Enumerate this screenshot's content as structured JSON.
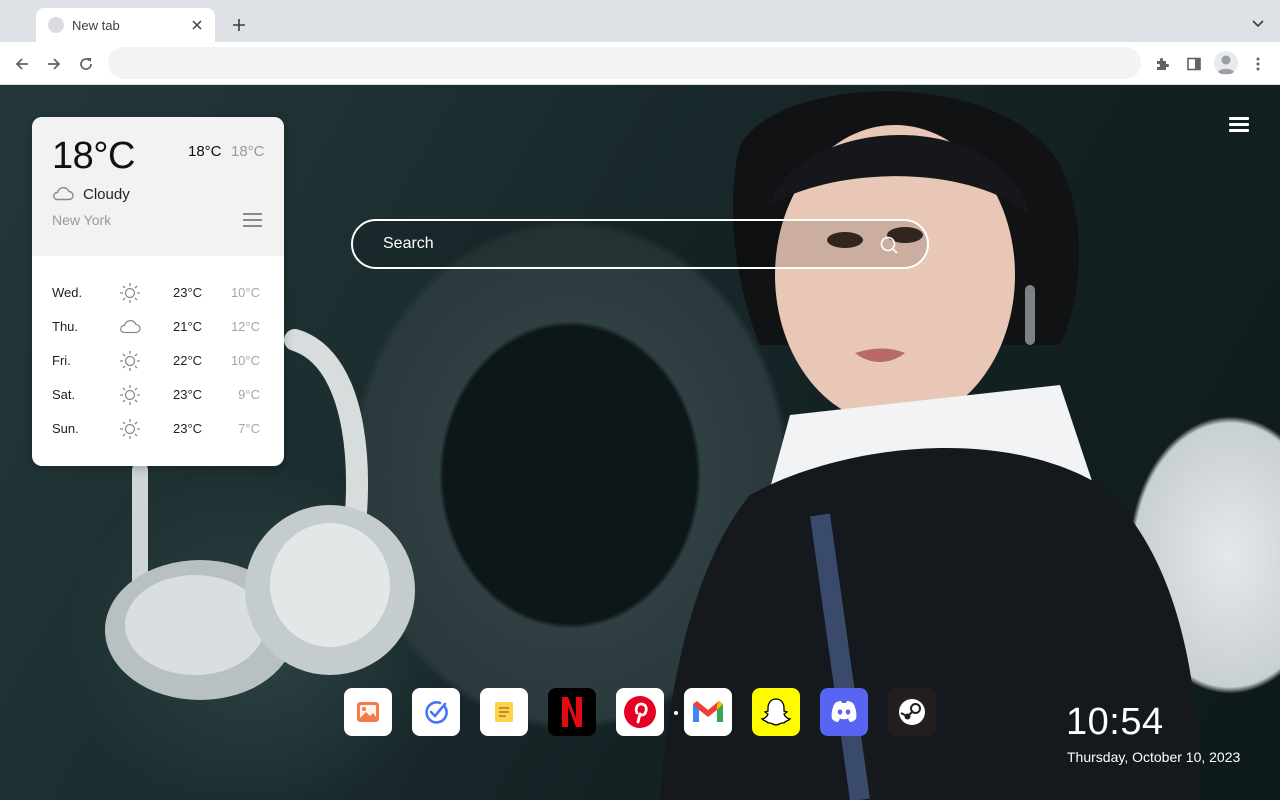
{
  "browser": {
    "tab_title": "New tab",
    "address_value": "",
    "new_tab_label": "+"
  },
  "weather": {
    "current_temp": "18°C",
    "high": "18°C",
    "low": "18°C",
    "condition": "Cloudy",
    "condition_icon": "cloud-icon",
    "city": "New York",
    "forecast": [
      {
        "day": "Wed.",
        "icon": "sun-icon",
        "high": "23°C",
        "low": "10°C"
      },
      {
        "day": "Thu.",
        "icon": "cloud-icon",
        "high": "21°C",
        "low": "12°C"
      },
      {
        "day": "Fri.",
        "icon": "sun-icon",
        "high": "22°C",
        "low": "10°C"
      },
      {
        "day": "Sat.",
        "icon": "sun-icon",
        "high": "23°C",
        "low": "9°C"
      },
      {
        "day": "Sun.",
        "icon": "sun-icon",
        "high": "23°C",
        "low": "7°C"
      }
    ]
  },
  "search": {
    "placeholder": "Search"
  },
  "dock": {
    "apps": [
      {
        "name": "gallery",
        "icon": "gallery-icon",
        "color": "#ffffff"
      },
      {
        "name": "tasks",
        "icon": "check-icon",
        "color": "#ffffff"
      },
      {
        "name": "notes",
        "icon": "notes-icon",
        "color": "#ffffff"
      },
      {
        "name": "netflix",
        "icon": "netflix-icon",
        "color": "#000000"
      },
      {
        "name": "pinterest",
        "icon": "pinterest-icon",
        "color": "#ffffff"
      },
      {
        "name": "gmail",
        "icon": "gmail-icon",
        "color": "#ffffff"
      },
      {
        "name": "snapchat",
        "icon": "snapchat-icon",
        "color": "#fffc00"
      },
      {
        "name": "discord",
        "icon": "discord-icon",
        "color": "#5865f2"
      },
      {
        "name": "steam",
        "icon": "steam-icon",
        "color": "#231f20"
      }
    ]
  },
  "clock": {
    "time": "10:54",
    "date": "Thursday, October 10, 2023"
  },
  "colors": {
    "tabstrip": "#dee1e6",
    "accent_blue": "#4a74f5",
    "netflix_red": "#e50914",
    "pinterest_red": "#e60023"
  }
}
